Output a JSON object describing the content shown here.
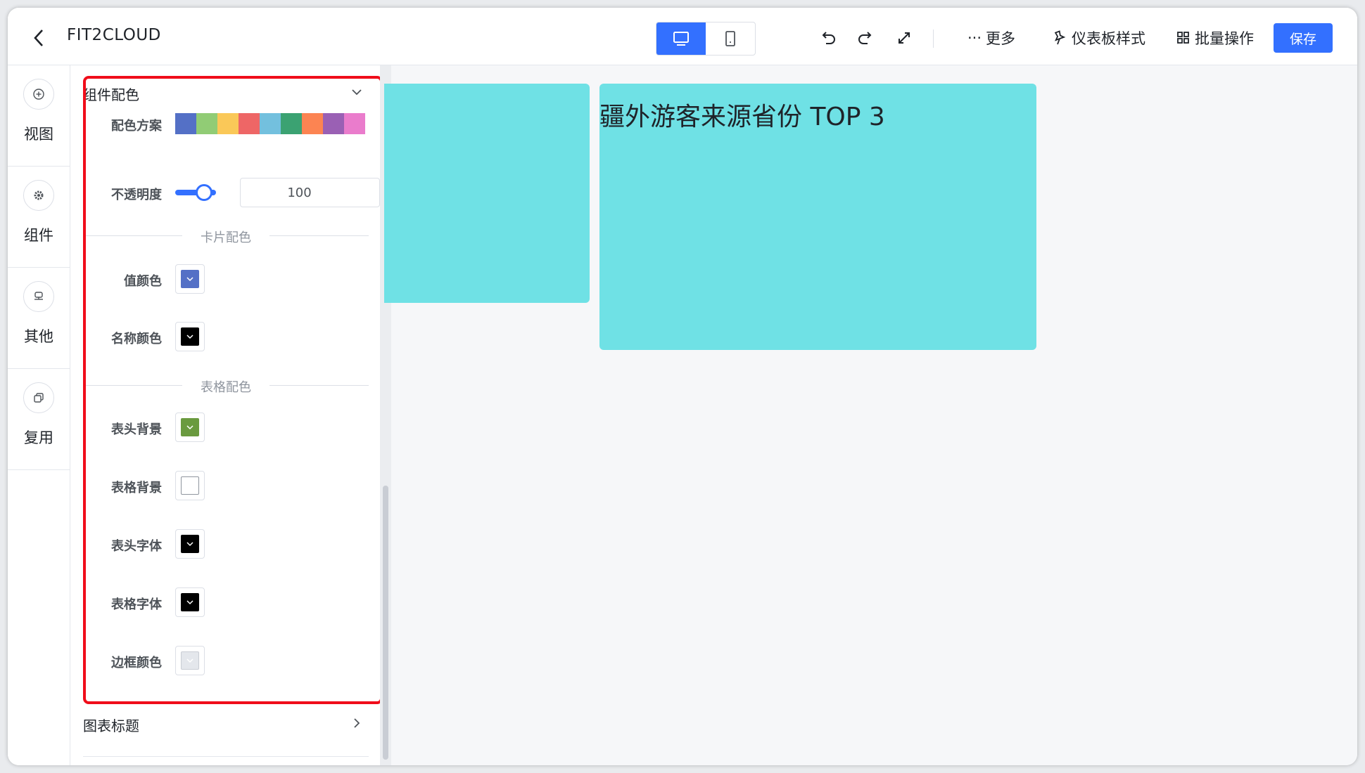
{
  "header": {
    "title": "FIT2CLOUD",
    "more_label": "更多",
    "dashboard_style_label": "仪表板样式",
    "batch_label": "批量操作",
    "save_label": "保存"
  },
  "rail": {
    "items": [
      {
        "label": "视图",
        "icon": "plus-circle-icon"
      },
      {
        "label": "组件",
        "icon": "gear-icon"
      },
      {
        "label": "其他",
        "icon": "stamp-icon"
      },
      {
        "label": "复用",
        "icon": "copy-icon"
      }
    ]
  },
  "panel": {
    "section_title": "组件配色",
    "scheme_label": "配色方案",
    "palette": [
      "#5470c6",
      "#91cc75",
      "#fac858",
      "#ee6666",
      "#73c0de",
      "#3ba272",
      "#fc8452",
      "#9a60b4",
      "#ea7ccc"
    ],
    "opacity_label": "不透明度",
    "opacity_value": "100",
    "opacity_fraction": 1.0,
    "card_divider": "卡片配色",
    "value_color_label": "值颜色",
    "value_color": "#5470c6",
    "name_color_label": "名称颜色",
    "name_color": "#000000",
    "table_divider": "表格配色",
    "header_bg_label": "表头背景",
    "header_bg_color": "#6a9a3f",
    "table_bg_label": "表格背景",
    "table_bg_color": "#ffffff",
    "header_font_label": "表头字体",
    "header_font_color": "#000000",
    "table_font_label": "表格字体",
    "table_font_color": "#000000",
    "border_color_label": "边框颜色",
    "border_color": "#e4e7ec",
    "chart_title_section": "图表标题"
  },
  "canvas": {
    "card2_title": "疆外游客来源省份 TOP 3",
    "card_color": "#6fe1e5"
  }
}
